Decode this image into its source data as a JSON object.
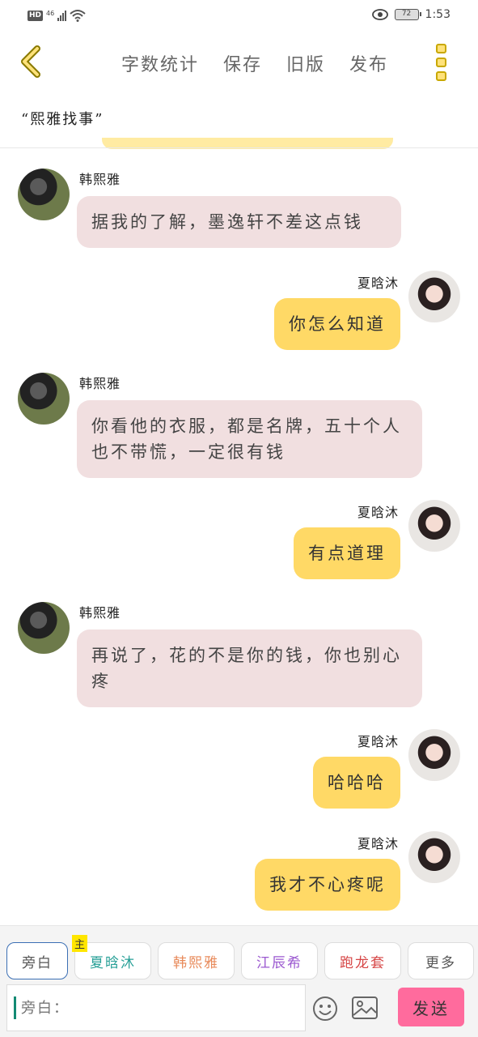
{
  "status_bar": {
    "hd": "HD",
    "network": "46",
    "battery": "72",
    "time": "1:53"
  },
  "top_bar": {
    "actions": [
      "字数统计",
      "保存",
      "旧版",
      "发布"
    ]
  },
  "story_title": "“熙雅找事”",
  "messages": [
    {
      "side": "left",
      "name": "韩熙雅",
      "text": "据我的了解，墨逸轩不差这点钱"
    },
    {
      "side": "right",
      "name": "夏晗沐",
      "text": "你怎么知道"
    },
    {
      "side": "left",
      "name": "韩熙雅",
      "text": "你看他的衣服，都是名牌，五十个人也不带慌，一定很有钱"
    },
    {
      "side": "right",
      "name": "夏晗沐",
      "text": "有点道理"
    },
    {
      "side": "left",
      "name": "韩熙雅",
      "text": "再说了，花的不是你的钱，你也别心疼"
    },
    {
      "side": "right",
      "name": "夏晗沐",
      "text": "哈哈哈"
    },
    {
      "side": "right",
      "name": "夏晗沐",
      "text": "我才不心疼呢"
    }
  ],
  "composer": {
    "roles": [
      {
        "label": "旁白",
        "color": "#555555"
      },
      {
        "label": "夏晗沐",
        "color": "#2aa198",
        "badge": "主"
      },
      {
        "label": "韩熙雅",
        "color": "#e88a5a"
      },
      {
        "label": "江辰希",
        "color": "#9b59d0"
      },
      {
        "label": "跑龙套",
        "color": "#d64545"
      },
      {
        "label": "更多",
        "color": "#555555"
      }
    ],
    "input_placeholder": "旁白：",
    "send_label": "发送"
  },
  "colors": {
    "accent": "#ffd966",
    "left_bubble": "#f1dfe0",
    "send": "#ff6b9d"
  }
}
